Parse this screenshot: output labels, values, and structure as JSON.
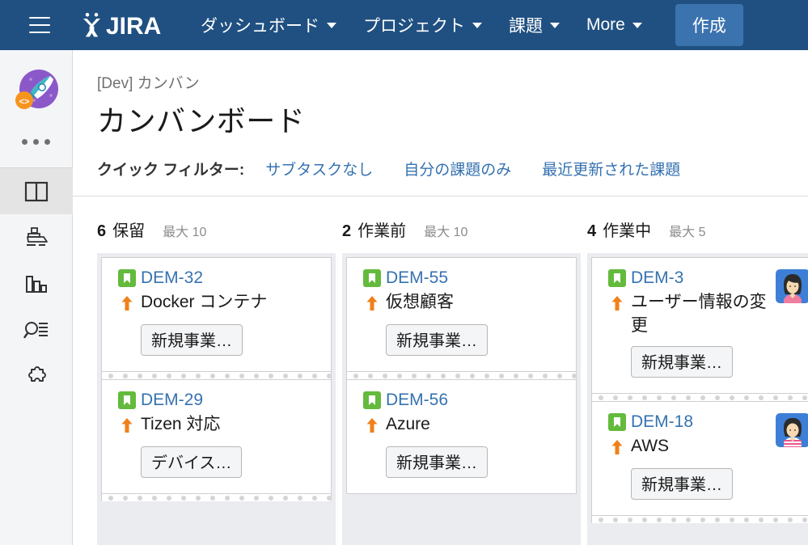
{
  "topnav": {
    "menu_icon": "hamburger-icon",
    "logo_text": "JIRA",
    "items": [
      {
        "label": "ダッシュボード",
        "has_caret": true
      },
      {
        "label": "プロジェクト",
        "has_caret": true
      },
      {
        "label": "課題",
        "has_caret": true
      },
      {
        "label": "More",
        "has_caret": true
      }
    ],
    "create_label": "作成",
    "bg_color": "#205081",
    "create_bg_color": "#3b73af"
  },
  "sidebar": {
    "project_avatar": "rocket-avatar",
    "more_dots": "ellipsis-icon",
    "items": [
      {
        "icon": "board-columns-icon",
        "active": true
      },
      {
        "icon": "ship-release-icon",
        "active": false
      },
      {
        "icon": "bar-chart-reports-icon",
        "active": false
      },
      {
        "icon": "issues-search-icon",
        "active": false
      },
      {
        "icon": "puzzle-addons-icon",
        "active": false
      }
    ]
  },
  "header": {
    "breadcrumb": "[Dev] カンバン",
    "title": "カンバンボード"
  },
  "filters": {
    "label": "クイック フィルター:",
    "links": [
      "サブタスクなし",
      "自分の課題のみ",
      "最近更新された課題"
    ],
    "link_color": "#3572b0"
  },
  "board": {
    "columns": [
      {
        "count": "6",
        "name": "保留",
        "max_label": "最大 10",
        "cards": [
          {
            "key": "DEM-32",
            "summary": "Docker コンテナ",
            "type_icon": "story-icon",
            "priority_icon": "priority-high-up-arrow",
            "epic": "新規事業…",
            "avatar": null
          },
          {
            "key": "DEM-29",
            "summary": "Tizen 対応",
            "type_icon": "story-icon",
            "priority_icon": "priority-high-up-arrow",
            "epic": "デバイス…",
            "avatar": null
          }
        ]
      },
      {
        "count": "2",
        "name": "作業前",
        "max_label": "最大 10",
        "cards": [
          {
            "key": "DEM-55",
            "summary": "仮想顧客",
            "type_icon": "story-icon",
            "priority_icon": "priority-high-up-arrow",
            "epic": "新規事業…",
            "avatar": null
          },
          {
            "key": "DEM-56",
            "summary": "Azure",
            "type_icon": "story-icon",
            "priority_icon": "priority-high-up-arrow",
            "epic": "新規事業…",
            "avatar": null
          }
        ]
      },
      {
        "count": "4",
        "name": "作業中",
        "max_label": "最大 5",
        "cards": [
          {
            "key": "DEM-3",
            "summary": "ユーザー情報の変更",
            "type_icon": "story-icon",
            "priority_icon": "priority-high-up-arrow",
            "epic": "新規事業…",
            "avatar": "avatar-long-hair-pink-top"
          },
          {
            "key": "DEM-18",
            "summary": "AWS",
            "type_icon": "story-icon",
            "priority_icon": "priority-high-up-arrow",
            "epic": "新規事業…",
            "avatar": "avatar-bob-hair-striped-top"
          }
        ]
      }
    ]
  },
  "colors": {
    "story_green": "#63ba3c",
    "priority_orange": "#f0801a",
    "link_blue": "#3572b0",
    "column_bg": "#ebecf0"
  }
}
